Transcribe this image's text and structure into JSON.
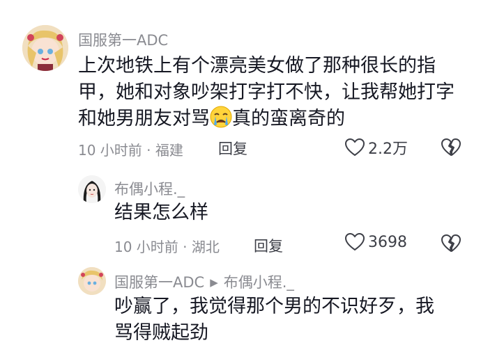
{
  "comments": [
    {
      "username": "国服第一ADC",
      "text_part1": "上次地铁上有个漂亮美女做了那种很长的指甲，她和对象吵架打字打不快，让我帮她打字和她男朋友对骂",
      "text_part2": "真的蛮离奇的",
      "emoji": "crying-face-emoji",
      "time": "10 小时前",
      "location": "福建",
      "reply_label": "回复",
      "likes": "2.2万"
    },
    {
      "username": "布偶小程._",
      "text": "结果怎么样",
      "time": "10 小时前",
      "location": "湖北",
      "reply_label": "回复",
      "likes": "3698"
    },
    {
      "username": "国服第一ADC",
      "reply_to": "布偶小程._",
      "text": "吵赢了，我觉得那个男的不识好歹，我骂得贼起劲"
    }
  ],
  "meta_separator": " · ",
  "colors": {
    "secondary_text": "#8a8b91",
    "primary_text": "#161823"
  }
}
